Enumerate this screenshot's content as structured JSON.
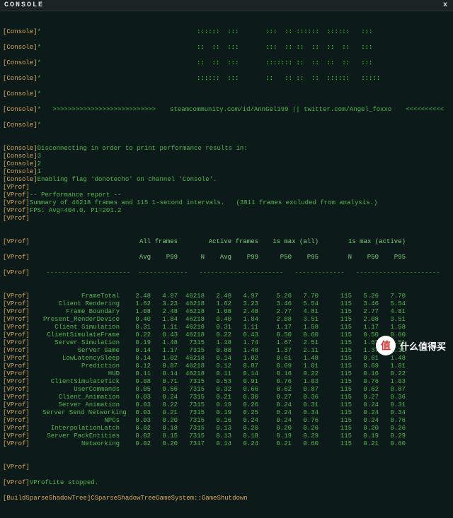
{
  "title": "CONSOLE",
  "ascii": [
    "::::::  :::       :::  :: ::::::  ::::::   :::",
    "::  ::  :::       :::  :: ::  ::  ::  ::   :::",
    "::  ::  :::       ::::::: ::  ::  ::  ::   :::",
    "::::::  :::       ::   :: ::  ::  ::::::   :::::"
  ],
  "banner_left": ">>>>>>>>>>>>>>>>>>>>>>>>>>>",
  "banner_mid": "steamcommunity.com/id/AnnGel199 || twitter.com/Angel_foxxo",
  "banner_right": "<<<<<<<<<<",
  "lines": [
    {
      "tag": "[Console]",
      "txt": "Disconnecting in order to print performance results in:"
    },
    {
      "tag": "[Console]",
      "txt": "3"
    },
    {
      "tag": "[Console]",
      "txt": "2"
    },
    {
      "tag": "[Console]",
      "txt": "1"
    },
    {
      "tag": "[Console]",
      "txt": "Enabling flag 'donotecho' on channel 'Console'."
    },
    {
      "tag": "[VProf]",
      "txt": ""
    },
    {
      "tag": "[VProf]",
      "txt": "-- Performance report --"
    },
    {
      "tag": "[VProf]",
      "txt": "Summary of 46218 frames and 115 1-second intervals.   (3811 frames excluded from analysis.)"
    },
    {
      "tag": "[VProf]",
      "txt": "FPS: Avg=404.0, P1=201.2"
    },
    {
      "tag": "[VProf]",
      "txt": ""
    }
  ],
  "hdr1": {
    "c0": "All frames",
    "c1": "Active frames",
    "c2": "1s max (all)",
    "c3": "1s max (active)"
  },
  "hdr2": [
    "Avg",
    "P99",
    "N",
    "Avg",
    "P99",
    "P50",
    "P95",
    "N",
    "P50",
    "P95"
  ],
  "rows": [
    {
      "name": "FrameTotal",
      "v": [
        "2.48",
        "4.97",
        "46218",
        "2.48",
        "4.97",
        "5.26",
        "7.70",
        "115",
        "5.26",
        "7.70"
      ]
    },
    {
      "name": "Client Rendering",
      "v": [
        "1.62",
        "3.23",
        "46218",
        "1.62",
        "3.23",
        "3.46",
        "5.54",
        "115",
        "3.46",
        "5.54"
      ]
    },
    {
      "name": "Frame Boundary",
      "v": [
        "1.08",
        "2.48",
        "46218",
        "1.08",
        "2.48",
        "2.77",
        "4.81",
        "115",
        "2.77",
        "4.81"
      ]
    },
    {
      "name": "Present_RenderDevice",
      "v": [
        "0.40",
        "1.84",
        "46218",
        "0.40",
        "1.84",
        "2.08",
        "3.51",
        "115",
        "2.08",
        "3.51"
      ]
    },
    {
      "name": "Client Simulation",
      "v": [
        "0.31",
        "1.11",
        "46218",
        "0.31",
        "1.11",
        "1.17",
        "1.58",
        "115",
        "1.17",
        "1.58"
      ]
    },
    {
      "name": "ClientSimulateFrame",
      "v": [
        "0.22",
        "0.43",
        "46218",
        "0.22",
        "0.43",
        "0.50",
        "0.60",
        "115",
        "0.50",
        "0.60"
      ]
    },
    {
      "name": "Server Simulation",
      "v": [
        "0.19",
        "1.48",
        "7315",
        "1.18",
        "1.74",
        "1.67",
        "2.51",
        "115",
        "1.67",
        "2.51"
      ]
    },
    {
      "name": "Server Game",
      "v": [
        "0.14",
        "1.17",
        "7315",
        "0.88",
        "1.48",
        "1.37",
        "2.11",
        "115",
        "1.37",
        "2.11"
      ]
    },
    {
      "name": "LowLatencySleep",
      "v": [
        "0.14",
        "1.02",
        "46218",
        "0.14",
        "1.02",
        "0.61",
        "1.48",
        "115",
        "0.61",
        "1.48"
      ]
    },
    {
      "name": "Prediction",
      "v": [
        "0.12",
        "0.87",
        "46218",
        "0.12",
        "0.87",
        "0.69",
        "1.01",
        "115",
        "0.69",
        "1.01"
      ]
    },
    {
      "name": "HUD",
      "v": [
        "0.11",
        "0.14",
        "46218",
        "0.11",
        "0.14",
        "0.16",
        "0.22",
        "115",
        "0.16",
        "0.22"
      ]
    },
    {
      "name": "ClientSimulateTick",
      "v": [
        "0.08",
        "0.71",
        "7315",
        "0.53",
        "0.91",
        "0.76",
        "1.03",
        "115",
        "0.76",
        "1.03"
      ]
    },
    {
      "name": "UserCommands",
      "v": [
        "0.05",
        "0.56",
        "7315",
        "0.32",
        "0.66",
        "0.62",
        "0.87",
        "115",
        "0.62",
        "0.87"
      ]
    },
    {
      "name": "Client_Animation",
      "v": [
        "0.03",
        "0.24",
        "7315",
        "0.21",
        "0.30",
        "0.27",
        "0.36",
        "115",
        "0.27",
        "0.36"
      ]
    },
    {
      "name": "Server Animation",
      "v": [
        "0.03",
        "0.22",
        "7315",
        "0.19",
        "0.26",
        "0.24",
        "0.31",
        "115",
        "0.24",
        "0.31"
      ]
    },
    {
      "name": "Server Send Networking",
      "v": [
        "0.03",
        "0.21",
        "7315",
        "0.19",
        "0.25",
        "0.24",
        "0.34",
        "115",
        "0.24",
        "0.34"
      ]
    },
    {
      "name": "NPCs",
      "v": [
        "0.03",
        "0.20",
        "7315",
        "0.16",
        "0.24",
        "0.24",
        "0.76",
        "115",
        "0.24",
        "0.76"
      ]
    },
    {
      "name": "InterpolationLatch",
      "v": [
        "0.02",
        "0.18",
        "7315",
        "0.13",
        "0.20",
        "0.20",
        "0.26",
        "115",
        "0.20",
        "0.26"
      ]
    },
    {
      "name": "Server PackEntities",
      "v": [
        "0.02",
        "0.15",
        "7315",
        "0.13",
        "0.18",
        "0.19",
        "0.29",
        "115",
        "0.19",
        "0.29"
      ]
    },
    {
      "name": "Networking",
      "v": [
        "0.02",
        "0.20",
        "7317",
        "0.14",
        "0.24",
        "0.21",
        "0.60",
        "115",
        "0.21",
        "0.60"
      ]
    }
  ],
  "footer1": {
    "tag": "[VProf]",
    "txt": "VProfLite stopped."
  },
  "footer2": {
    "tag": "[BuildSparseShadowTree]",
    "txt": "CSparseShadowTreeGameSystem::GameShutdown"
  },
  "watermark": {
    "icon": "值",
    "text": "什么值得买"
  }
}
